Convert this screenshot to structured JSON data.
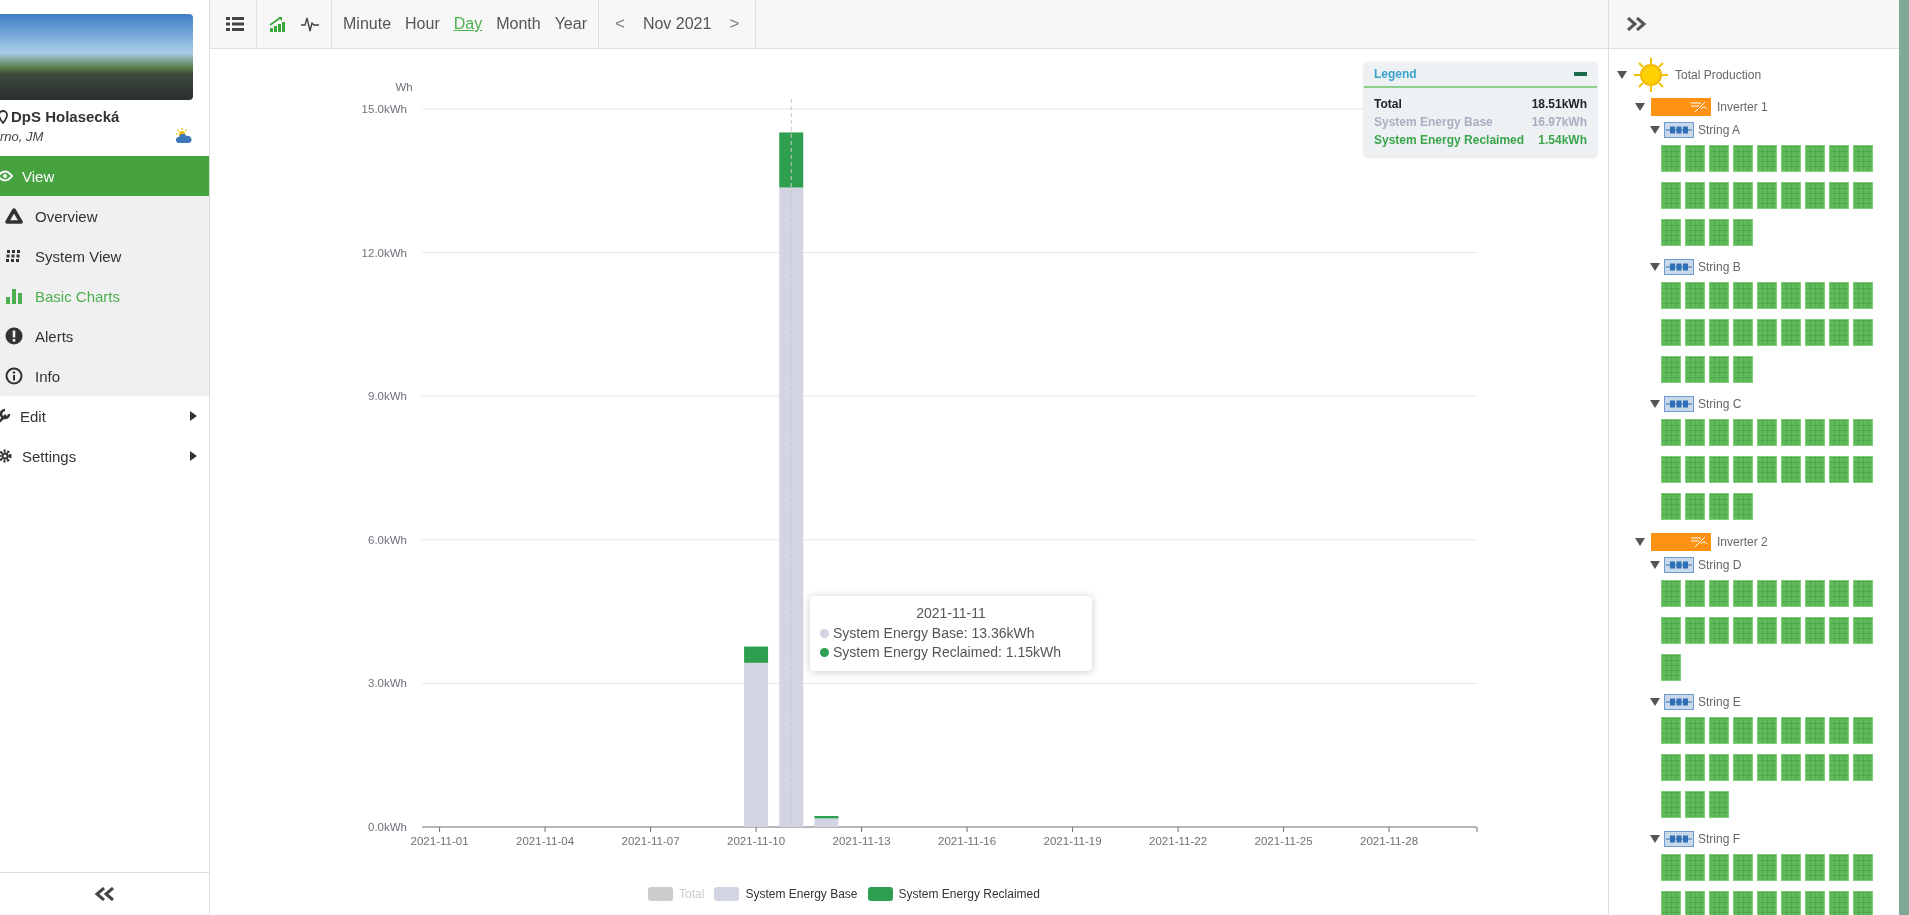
{
  "sidebar": {
    "site_name": "DpS Holasecká",
    "location": "rno, JM",
    "menu": [
      {
        "label": "View",
        "expanded": true,
        "children": [
          {
            "label": "Overview",
            "selected": false
          },
          {
            "label": "System View",
            "selected": false
          },
          {
            "label": "Basic Charts",
            "selected": true
          },
          {
            "label": "Alerts",
            "selected": false
          },
          {
            "label": "Info",
            "selected": false
          }
        ]
      },
      {
        "label": "Edit",
        "expanded": false
      },
      {
        "label": "Settings",
        "expanded": false
      }
    ]
  },
  "toolbar": {
    "chart_modes": [
      {
        "selected": true
      },
      {
        "selected": false
      }
    ],
    "periods": [
      {
        "label": "Minute",
        "selected": false
      },
      {
        "label": "Hour",
        "selected": false
      },
      {
        "label": "Day",
        "selected": true
      },
      {
        "label": "Month",
        "selected": false
      },
      {
        "label": "Year",
        "selected": false
      }
    ],
    "prev": "<",
    "range": "Nov 2021",
    "next": ">"
  },
  "chart": {
    "legend_box": {
      "title": "Legend",
      "rows": [
        {
          "label": "Total",
          "value": "18.51kWh",
          "color": "#222222"
        },
        {
          "label": "System Energy Base",
          "value": "16.97kWh",
          "color": "#a9aec0"
        },
        {
          "label": "System Energy Reclaimed",
          "value": "1.54kWh",
          "color": "#3aa54a"
        }
      ]
    },
    "tooltip": {
      "title": "2021-11-11",
      "rows": [
        {
          "text": "System Energy Base: 13.36kWh",
          "color": "#d3d4e3"
        },
        {
          "text": "System Energy Reclaimed: 1.15kWh",
          "color": "#2e9e4f"
        }
      ]
    },
    "chart_data": {
      "type": "bar",
      "stacked": true,
      "grid": true,
      "ylabel": "Wh",
      "categories": [
        "2021-11-01",
        null,
        null,
        "2021-11-04",
        null,
        null,
        "2021-11-07",
        null,
        null,
        "2021-11-10",
        null,
        null,
        "2021-11-13",
        null,
        null,
        "2021-11-16",
        null,
        null,
        "2021-11-19",
        null,
        null,
        "2021-11-22",
        null,
        null,
        "2021-11-25",
        null,
        null,
        "2021-11-28",
        null,
        null
      ],
      "series": [
        {
          "name": "System Energy Base",
          "color": "#d3d4e3",
          "values": [
            0,
            0,
            0,
            0,
            0,
            0,
            0,
            0,
            0,
            3.43,
            13.36,
            0.18,
            0,
            0,
            0,
            0,
            0,
            0,
            0,
            0,
            0,
            0,
            0,
            0,
            0,
            0,
            0,
            0,
            0,
            0
          ]
        },
        {
          "name": "System Energy Reclaimed",
          "color": "#2e9e4f",
          "values": [
            0,
            0,
            0,
            0,
            0,
            0,
            0,
            0,
            0,
            0.34,
            1.15,
            0.05,
            0,
            0,
            0,
            0,
            0,
            0,
            0,
            0,
            0,
            0,
            0,
            0,
            0,
            0,
            0,
            0,
            0,
            0
          ]
        }
      ],
      "ylim": [
        0,
        15
      ],
      "yticks": [
        {
          "value": 0,
          "label": "0.0kWh"
        },
        {
          "value": 3,
          "label": "3.0kWh"
        },
        {
          "value": 6,
          "label": "6.0kWh"
        },
        {
          "value": 9,
          "label": "9.0kWh"
        },
        {
          "value": 12,
          "label": "12.0kWh"
        },
        {
          "value": 15,
          "label": "15.0kWh"
        }
      ]
    },
    "series_toggles": [
      {
        "label": "Total",
        "color": "#cccccc",
        "on": false
      }
    ]
  },
  "tree": {
    "label": "Total Production",
    "expanded": true,
    "children": [
      {
        "label": "Inverter 1",
        "expanded": true,
        "children": [
          {
            "label": "String A",
            "expanded": true,
            "panels": [
              {
                "on": true
              },
              {
                "on": true
              },
              {
                "on": true
              },
              {
                "on": true
              },
              {
                "on": true
              },
              {
                "on": true
              },
              {
                "on": true
              },
              {
                "on": true
              },
              {
                "on": true
              },
              {
                "on": true
              },
              {
                "on": true
              },
              {
                "on": true
              },
              {
                "on": true
              },
              {
                "on": true
              },
              {
                "on": true
              },
              {
                "on": true
              },
              {
                "on": true
              },
              {
                "on": true
              },
              {
                "on": true
              },
              {
                "on": true
              },
              {
                "on": true
              },
              {
                "on": true
              }
            ]
          },
          {
            "label": "String B",
            "expanded": true,
            "panels": [
              {
                "on": true
              },
              {
                "on": true
              },
              {
                "on": true
              },
              {
                "on": true
              },
              {
                "on": true
              },
              {
                "on": true
              },
              {
                "on": true
              },
              {
                "on": true
              },
              {
                "on": true
              },
              {
                "on": true
              },
              {
                "on": true
              },
              {
                "on": true
              },
              {
                "on": true
              },
              {
                "on": true
              },
              {
                "on": true
              },
              {
                "on": true
              },
              {
                "on": true
              },
              {
                "on": true
              },
              {
                "on": true
              },
              {
                "on": true
              },
              {
                "on": true
              },
              {
                "on": true
              }
            ]
          },
          {
            "label": "String C",
            "expanded": true,
            "panels": [
              {
                "on": true
              },
              {
                "on": true
              },
              {
                "on": true
              },
              {
                "on": true
              },
              {
                "on": true
              },
              {
                "on": true
              },
              {
                "on": true
              },
              {
                "on": true
              },
              {
                "on": true
              },
              {
                "on": true
              },
              {
                "on": true
              },
              {
                "on": true
              },
              {
                "on": true
              },
              {
                "on": true
              },
              {
                "on": true
              },
              {
                "on": true
              },
              {
                "on": true
              },
              {
                "on": true
              },
              {
                "on": true
              },
              {
                "on": true
              },
              {
                "on": true
              },
              {
                "on": true
              }
            ]
          }
        ]
      },
      {
        "label": "Inverter 2",
        "expanded": true,
        "children": [
          {
            "label": "String D",
            "expanded": true,
            "panels": [
              {
                "on": true
              },
              {
                "on": true
              },
              {
                "on": true
              },
              {
                "on": true
              },
              {
                "on": true
              },
              {
                "on": true
              },
              {
                "on": true
              },
              {
                "on": true
              },
              {
                "on": true
              },
              {
                "on": true
              },
              {
                "on": true
              },
              {
                "on": true
              },
              {
                "on": true
              },
              {
                "on": true
              },
              {
                "on": true
              },
              {
                "on": true
              },
              {
                "on": true
              },
              {
                "on": true
              },
              {
                "on": true
              }
            ]
          },
          {
            "label": "String E",
            "expanded": true,
            "panels": [
              {
                "on": true
              },
              {
                "on": true
              },
              {
                "on": true
              },
              {
                "on": true
              },
              {
                "on": true
              },
              {
                "on": true
              },
              {
                "on": true
              },
              {
                "on": true
              },
              {
                "on": true
              },
              {
                "on": true
              },
              {
                "on": true
              },
              {
                "on": true
              },
              {
                "on": true
              },
              {
                "on": true
              },
              {
                "on": true
              },
              {
                "on": true
              },
              {
                "on": true
              },
              {
                "on": true
              },
              {
                "on": true
              },
              {
                "on": true
              },
              {
                "on": true
              }
            ]
          },
          {
            "label": "String F",
            "expanded": true,
            "panels": [
              {
                "on": true
              },
              {
                "on": true
              },
              {
                "on": true
              },
              {
                "on": true
              },
              {
                "on": true
              },
              {
                "on": true
              },
              {
                "on": true
              },
              {
                "on": true
              },
              {
                "on": true
              },
              {
                "on": true
              },
              {
                "on": true
              },
              {
                "on": true
              },
              {
                "on": true
              },
              {
                "on": true
              },
              {
                "on": true
              },
              {
                "on": true
              },
              {
                "on": true
              },
              {
                "on": true
              }
            ]
          }
        ]
      }
    ]
  }
}
